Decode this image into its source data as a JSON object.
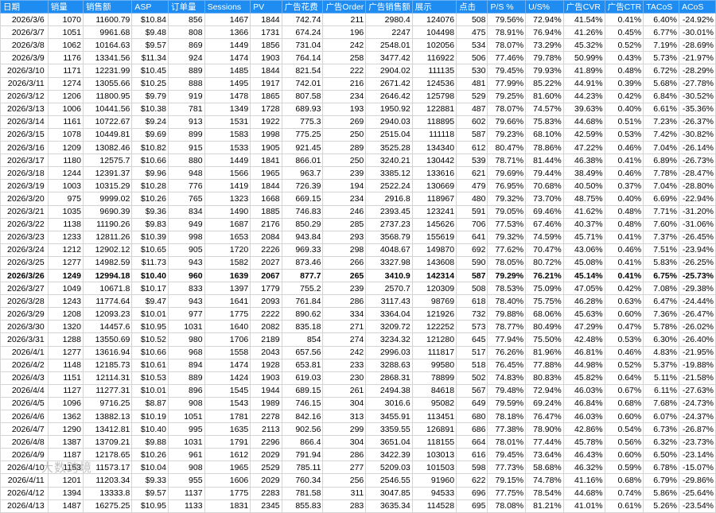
{
  "table": {
    "headers": [
      "日期",
      "销量",
      "销售额",
      "ASP",
      "订单量",
      "Sessions",
      "PV",
      "广告花费",
      "广告Order",
      "广告销售额",
      "展示",
      "点击",
      "P/S %",
      "U/S%",
      "广告CVR",
      "广告CTR",
      "TACoS",
      "ACoS"
    ],
    "highlight_row_index": 20,
    "rows": [
      [
        "2026/3/6",
        "1070",
        "11600.79",
        "$10.84",
        "856",
        "1467",
        "1844",
        "742.74",
        "211",
        "2980.4",
        "124076",
        "508",
        "79.56%",
        "72.94%",
        "41.54%",
        "0.41%",
        "6.40%",
        "-24.92%"
      ],
      [
        "2026/3/7",
        "1051",
        "9961.68",
        "$9.48",
        "808",
        "1366",
        "1731",
        "674.24",
        "196",
        "2247",
        "104498",
        "475",
        "78.91%",
        "76.94%",
        "41.26%",
        "0.45%",
        "6.77%",
        "-30.01%"
      ],
      [
        "2026/3/8",
        "1062",
        "10164.63",
        "$9.57",
        "869",
        "1449",
        "1856",
        "731.04",
        "242",
        "2548.01",
        "102056",
        "534",
        "78.07%",
        "73.29%",
        "45.32%",
        "0.52%",
        "7.19%",
        "-28.69%"
      ],
      [
        "2026/3/9",
        "1176",
        "13341.56",
        "$11.34",
        "924",
        "1474",
        "1903",
        "764.14",
        "258",
        "3477.42",
        "116922",
        "506",
        "77.46%",
        "79.78%",
        "50.99%",
        "0.43%",
        "5.73%",
        "-21.97%"
      ],
      [
        "2026/3/10",
        "1171",
        "12231.99",
        "$10.45",
        "889",
        "1485",
        "1844",
        "821.54",
        "222",
        "2904.02",
        "111135",
        "530",
        "79.45%",
        "79.93%",
        "41.89%",
        "0.48%",
        "6.72%",
        "-28.29%"
      ],
      [
        "2026/3/11",
        "1274",
        "13055.66",
        "$10.25",
        "888",
        "1495",
        "1917",
        "742.01",
        "216",
        "2671.42",
        "124536",
        "481",
        "77.99%",
        "85.22%",
        "44.91%",
        "0.39%",
        "5.68%",
        "-27.78%"
      ],
      [
        "2026/3/12",
        "1206",
        "11800.95",
        "$9.79",
        "919",
        "1478",
        "1865",
        "807.58",
        "234",
        "2646.42",
        "125798",
        "529",
        "79.25%",
        "81.60%",
        "44.23%",
        "0.42%",
        "6.84%",
        "-30.52%"
      ],
      [
        "2026/3/13",
        "1006",
        "10441.56",
        "$10.38",
        "781",
        "1349",
        "1728",
        "689.93",
        "193",
        "1950.92",
        "122881",
        "487",
        "78.07%",
        "74.57%",
        "39.63%",
        "0.40%",
        "6.61%",
        "-35.36%"
      ],
      [
        "2026/3/14",
        "1161",
        "10722.67",
        "$9.24",
        "913",
        "1531",
        "1922",
        "775.3",
        "269",
        "2940.03",
        "118895",
        "602",
        "79.66%",
        "75.83%",
        "44.68%",
        "0.51%",
        "7.23%",
        "-26.37%"
      ],
      [
        "2026/3/15",
        "1078",
        "10449.81",
        "$9.69",
        "899",
        "1583",
        "1998",
        "775.25",
        "250",
        "2515.04",
        "111118",
        "587",
        "79.23%",
        "68.10%",
        "42.59%",
        "0.53%",
        "7.42%",
        "-30.82%"
      ],
      [
        "2026/3/16",
        "1209",
        "13082.46",
        "$10.82",
        "915",
        "1533",
        "1905",
        "921.45",
        "289",
        "3525.28",
        "134340",
        "612",
        "80.47%",
        "78.86%",
        "47.22%",
        "0.46%",
        "7.04%",
        "-26.14%"
      ],
      [
        "2026/3/17",
        "1180",
        "12575.7",
        "$10.66",
        "880",
        "1449",
        "1841",
        "866.01",
        "250",
        "3240.21",
        "130442",
        "539",
        "78.71%",
        "81.44%",
        "46.38%",
        "0.41%",
        "6.89%",
        "-26.73%"
      ],
      [
        "2026/3/18",
        "1244",
        "12391.37",
        "$9.96",
        "948",
        "1566",
        "1965",
        "963.7",
        "239",
        "3385.12",
        "133616",
        "621",
        "79.69%",
        "79.44%",
        "38.49%",
        "0.46%",
        "7.78%",
        "-28.47%"
      ],
      [
        "2026/3/19",
        "1003",
        "10315.29",
        "$10.28",
        "776",
        "1419",
        "1844",
        "726.39",
        "194",
        "2522.24",
        "130669",
        "479",
        "76.95%",
        "70.68%",
        "40.50%",
        "0.37%",
        "7.04%",
        "-28.80%"
      ],
      [
        "2026/3/20",
        "975",
        "9999.02",
        "$10.26",
        "765",
        "1323",
        "1668",
        "669.15",
        "234",
        "2916.8",
        "118967",
        "480",
        "79.32%",
        "73.70%",
        "48.75%",
        "0.40%",
        "6.69%",
        "-22.94%"
      ],
      [
        "2026/3/21",
        "1035",
        "9690.39",
        "$9.36",
        "834",
        "1490",
        "1885",
        "746.83",
        "246",
        "2393.45",
        "123241",
        "591",
        "79.05%",
        "69.46%",
        "41.62%",
        "0.48%",
        "7.71%",
        "-31.20%"
      ],
      [
        "2026/3/22",
        "1138",
        "11190.26",
        "$9.83",
        "949",
        "1687",
        "2176",
        "850.29",
        "285",
        "2737.23",
        "145626",
        "706",
        "77.53%",
        "67.46%",
        "40.37%",
        "0.48%",
        "7.60%",
        "-31.06%"
      ],
      [
        "2026/3/23",
        "1233",
        "12811.26",
        "$10.39",
        "998",
        "1653",
        "2084",
        "943.84",
        "293",
        "3568.79",
        "155619",
        "641",
        "79.32%",
        "74.59%",
        "45.71%",
        "0.41%",
        "7.37%",
        "-26.45%"
      ],
      [
        "2026/3/24",
        "1212",
        "12902.12",
        "$10.65",
        "905",
        "1720",
        "2226",
        "969.33",
        "298",
        "4048.67",
        "149870",
        "692",
        "77.62%",
        "70.47%",
        "43.06%",
        "0.46%",
        "7.51%",
        "-23.94%"
      ],
      [
        "2026/3/25",
        "1277",
        "14982.59",
        "$11.73",
        "943",
        "1582",
        "2027",
        "873.46",
        "266",
        "3327.98",
        "143608",
        "590",
        "78.05%",
        "80.72%",
        "45.08%",
        "0.41%",
        "5.83%",
        "-26.25%"
      ],
      [
        "2026/3/26",
        "1249",
        "12994.18",
        "$10.40",
        "960",
        "1639",
        "2067",
        "877.7",
        "265",
        "3410.9",
        "142314",
        "587",
        "79.29%",
        "76.21%",
        "45.14%",
        "0.41%",
        "6.75%",
        "-25.73%"
      ],
      [
        "2026/3/27",
        "1049",
        "10671.8",
        "$10.17",
        "833",
        "1397",
        "1779",
        "755.2",
        "239",
        "2570.7",
        "120309",
        "508",
        "78.53%",
        "75.09%",
        "47.05%",
        "0.42%",
        "7.08%",
        "-29.38%"
      ],
      [
        "2026/3/28",
        "1243",
        "11774.64",
        "$9.47",
        "943",
        "1641",
        "2093",
        "761.84",
        "286",
        "3117.43",
        "98769",
        "618",
        "78.40%",
        "75.75%",
        "46.28%",
        "0.63%",
        "6.47%",
        "-24.44%"
      ],
      [
        "2026/3/29",
        "1208",
        "12093.23",
        "$10.01",
        "977",
        "1775",
        "2222",
        "890.62",
        "334",
        "3364.04",
        "121926",
        "732",
        "79.88%",
        "68.06%",
        "45.63%",
        "0.60%",
        "7.36%",
        "-26.47%"
      ],
      [
        "2026/3/30",
        "1320",
        "14457.6",
        "$10.95",
        "1031",
        "1640",
        "2082",
        "835.18",
        "271",
        "3209.72",
        "122252",
        "573",
        "78.77%",
        "80.49%",
        "47.29%",
        "0.47%",
        "5.78%",
        "-26.02%"
      ],
      [
        "2026/3/31",
        "1288",
        "13550.69",
        "$10.52",
        "980",
        "1706",
        "2189",
        "854",
        "274",
        "3234.32",
        "121280",
        "645",
        "77.94%",
        "75.50%",
        "42.48%",
        "0.53%",
        "6.30%",
        "-26.40%"
      ],
      [
        "2026/4/1",
        "1277",
        "13616.94",
        "$10.66",
        "968",
        "1558",
        "2043",
        "657.56",
        "242",
        "2996.03",
        "111817",
        "517",
        "76.26%",
        "81.96%",
        "46.81%",
        "0.46%",
        "4.83%",
        "-21.95%"
      ],
      [
        "2026/4/2",
        "1148",
        "12185.73",
        "$10.61",
        "894",
        "1474",
        "1928",
        "653.81",
        "233",
        "3288.63",
        "99580",
        "518",
        "76.45%",
        "77.88%",
        "44.98%",
        "0.52%",
        "5.37%",
        "-19.88%"
      ],
      [
        "2026/4/3",
        "1151",
        "12114.31",
        "$10.53",
        "889",
        "1424",
        "1903",
        "619.03",
        "230",
        "2868.31",
        "78899",
        "502",
        "74.83%",
        "80.83%",
        "45.82%",
        "0.64%",
        "5.11%",
        "-21.58%"
      ],
      [
        "2026/4/4",
        "1127",
        "11277.31",
        "$10.01",
        "896",
        "1545",
        "1944",
        "689.15",
        "261",
        "2494.38",
        "84618",
        "567",
        "79.48%",
        "72.94%",
        "46.03%",
        "0.67%",
        "6.11%",
        "-27.63%"
      ],
      [
        "2026/4/5",
        "1096",
        "9716.25",
        "$8.87",
        "908",
        "1543",
        "1989",
        "746.15",
        "304",
        "3016.6",
        "95082",
        "649",
        "79.59%",
        "69.24%",
        "46.84%",
        "0.68%",
        "7.68%",
        "-24.73%"
      ],
      [
        "2026/4/6",
        "1362",
        "13882.13",
        "$10.19",
        "1051",
        "1781",
        "2278",
        "842.16",
        "313",
        "3455.91",
        "113451",
        "680",
        "78.18%",
        "76.47%",
        "46.03%",
        "0.60%",
        "6.07%",
        "-24.37%"
      ],
      [
        "2026/4/7",
        "1290",
        "13412.81",
        "$10.40",
        "995",
        "1635",
        "2113",
        "902.56",
        "299",
        "3359.55",
        "126891",
        "686",
        "77.38%",
        "78.90%",
        "42.86%",
        "0.54%",
        "6.73%",
        "-26.87%"
      ],
      [
        "2026/4/8",
        "1387",
        "13709.21",
        "$9.88",
        "1031",
        "1791",
        "2296",
        "866.4",
        "304",
        "3651.04",
        "118155",
        "664",
        "78.01%",
        "77.44%",
        "45.78%",
        "0.56%",
        "6.32%",
        "-23.73%"
      ],
      [
        "2026/4/9",
        "1187",
        "12178.65",
        "$10.26",
        "961",
        "1612",
        "2029",
        "791.94",
        "286",
        "3422.39",
        "103013",
        "616",
        "79.45%",
        "73.64%",
        "46.43%",
        "0.60%",
        "6.50%",
        "-23.14%"
      ],
      [
        "2026/4/10",
        "1153",
        "11573.17",
        "$10.04",
        "908",
        "1965",
        "2529",
        "785.11",
        "277",
        "5209.03",
        "101503",
        "598",
        "77.73%",
        "58.68%",
        "46.32%",
        "0.59%",
        "6.78%",
        "-15.07%"
      ],
      [
        "2026/4/11",
        "1201",
        "11203.34",
        "$9.33",
        "955",
        "1606",
        "2029",
        "760.34",
        "256",
        "2546.55",
        "91960",
        "622",
        "79.15%",
        "74.78%",
        "41.16%",
        "0.68%",
        "6.79%",
        "-29.86%"
      ],
      [
        "2026/4/12",
        "1394",
        "13333.8",
        "$9.57",
        "1137",
        "1775",
        "2283",
        "781.58",
        "311",
        "3047.85",
        "94533",
        "696",
        "77.75%",
        "78.54%",
        "44.68%",
        "0.74%",
        "5.86%",
        "-25.64%"
      ],
      [
        "2026/4/13",
        "1487",
        "16275.25",
        "$10.95",
        "1133",
        "1831",
        "2345",
        "855.83",
        "283",
        "3635.34",
        "114528",
        "695",
        "78.08%",
        "81.21%",
        "41.01%",
        "0.61%",
        "5.26%",
        "-23.54%"
      ]
    ]
  },
  "watermark": "大数跨境"
}
